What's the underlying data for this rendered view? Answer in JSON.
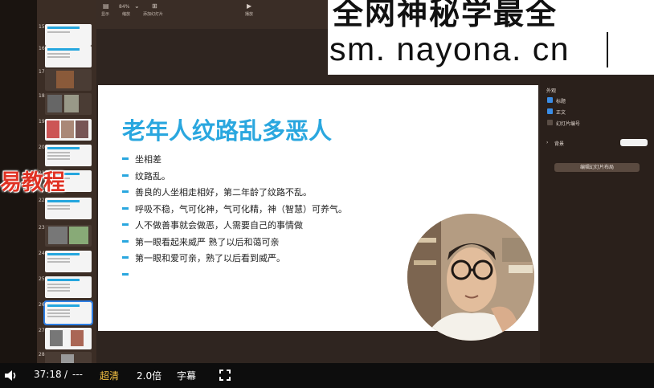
{
  "toolbar": {
    "zoom_value": "84%",
    "items": [
      {
        "icon": "sidebar-icon",
        "label": "显示"
      },
      {
        "icon": "zoom-icon",
        "label": "缩放"
      },
      {
        "icon": "add-slide-icon",
        "label": "添加幻灯片"
      },
      {
        "icon": "play-icon",
        "label": "播放"
      }
    ]
  },
  "watermark": {
    "top_text": "全网神秘学最全",
    "url": "sm. nayona. cn"
  },
  "overlay_text": "易教程",
  "slide": {
    "title": "老年人纹路乱多恶人",
    "bullets": [
      "坐相差",
      "纹路乱。",
      "善良的人坐相走相好，第二年龄了纹路不乱。",
      "呼吸不稳，气可化神，气可化精，神（智慧）可养气。",
      "人不做善事就会做恶，人需要自己的事情做",
      "第一眼看起来威严 熟了以后和蔼可亲",
      "第一眼和爱可亲，熟了以后看到威严。",
      ""
    ]
  },
  "thumbnails": [
    {
      "num": "15",
      "kind": "text"
    },
    {
      "num": "16",
      "kind": "text"
    },
    {
      "num": "17",
      "kind": "photo"
    },
    {
      "num": "18",
      "kind": "photo"
    },
    {
      "num": "19",
      "kind": "photo"
    },
    {
      "num": "20",
      "kind": "text"
    },
    {
      "num": "21",
      "kind": "text"
    },
    {
      "num": "22",
      "kind": "text"
    },
    {
      "num": "23",
      "kind": "photo"
    },
    {
      "num": "24",
      "kind": "text"
    },
    {
      "num": "25",
      "kind": "text"
    },
    {
      "num": "26",
      "kind": "selected"
    },
    {
      "num": "27",
      "kind": "photo"
    },
    {
      "num": "28",
      "kind": "photo"
    }
  ],
  "right_panel": {
    "section_title": "外观",
    "options": [
      {
        "label": "标题",
        "checked": true
      },
      {
        "label": "正文",
        "checked": true
      },
      {
        "label": "幻灯片编号",
        "checked": false
      }
    ],
    "background_label": "背景",
    "edit_layout_button": "编辑幻灯片布局"
  },
  "player": {
    "time": "37:18",
    "separator": "/",
    "duration": "---",
    "quality": "超清",
    "speed": "2.0倍",
    "subtitles": "字幕",
    "accent_color": "#f5c243"
  }
}
